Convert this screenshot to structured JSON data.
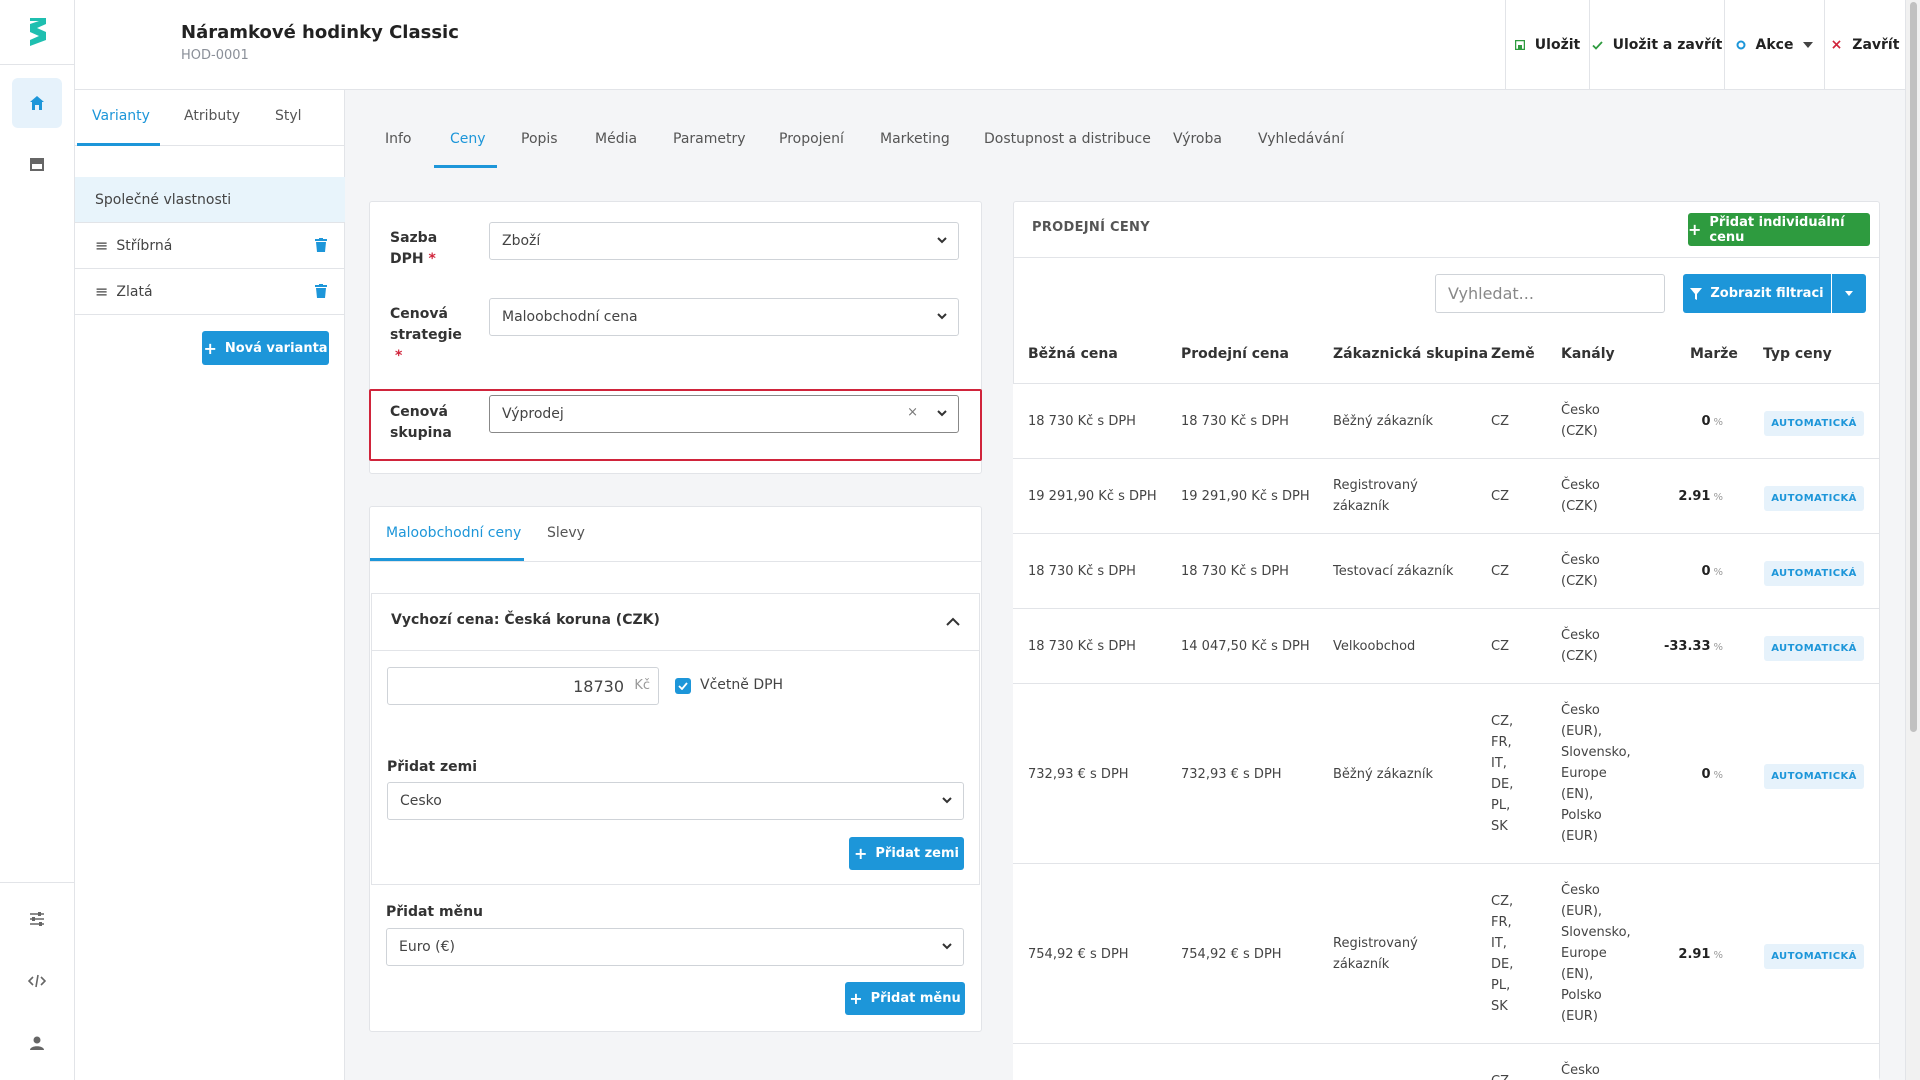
{
  "header": {
    "title": "Náramkové hodinky Classic",
    "code": "HOD-0001",
    "save": "Uložit",
    "save_close": "Uložit a zavřít",
    "actions": "Akce",
    "close": "Zavřít"
  },
  "rail": {
    "items": [
      "home-icon",
      "store-icon",
      "sliders-icon",
      "code-icon",
      "user-icon"
    ]
  },
  "variants": {
    "tabs": [
      "Varianty",
      "Atributy",
      "Styl"
    ],
    "shared": "Společné vlastnosti",
    "items": [
      "Stříbrná",
      "Zlatá"
    ],
    "new_button": "Nová varianta"
  },
  "main_tabs": [
    "Info",
    "Ceny",
    "Popis",
    "Média",
    "Parametry",
    "Propojení",
    "Marketing",
    "Dostupnost a distribuce",
    "Výroba",
    "Vyhledávání"
  ],
  "form": {
    "vat_label_1": "Sazba",
    "vat_label_2": "DPH",
    "vat_value": "Zboží",
    "strategy_label_1": "Cenová",
    "strategy_label_2": "strategie",
    "strategy_value": "Maloobchodní cena",
    "group_label_1": "Cenová",
    "group_label_2": "skupina",
    "group_value": "Výprodej",
    "required_mark": "*"
  },
  "price_tabs": [
    "Maloobchodní ceny",
    "Slevy"
  ],
  "default_price": {
    "title": "Vychozí cena: Česká koruna (CZK)",
    "value": "18730",
    "currency": "Kč",
    "incl_vat": "Včetně DPH",
    "add_country_label": "Přidat zemi",
    "country_value": "Cesko",
    "add_country_button": "Přidat zemi",
    "add_currency_label": "Přidat měnu",
    "currency_value": "Euro (€)",
    "add_currency_button": "Přidat měnu"
  },
  "sale_prices": {
    "title": "PRODEJNÍ CENY",
    "add_button": "Přidat individuální cenu",
    "search_placeholder": "Vyhledat...",
    "filter_button": "Zobrazit filtraci",
    "columns": [
      "Běžná cena",
      "Prodejní cena",
      "Zákaznická skupina",
      "Země",
      "Kanály",
      "Marže",
      "Typ ceny"
    ],
    "percent": "%",
    "rows": [
      {
        "regular": "18 730 Kč s DPH",
        "sale": "18 730 Kč s DPH",
        "group": [
          "Běžný zákazník"
        ],
        "country": [
          "CZ"
        ],
        "channels": [
          "Česko",
          "(CZK)"
        ],
        "margin": "0",
        "type": "AUTOMATICKÁ"
      },
      {
        "regular": "19 291,90 Kč s DPH",
        "sale": "19 291,90 Kč s DPH",
        "group": [
          "Registrovaný",
          "zákazník"
        ],
        "country": [
          "CZ"
        ],
        "channels": [
          "Česko",
          "(CZK)"
        ],
        "margin": "2.91",
        "type": "AUTOMATICKÁ"
      },
      {
        "regular": "18 730 Kč s DPH",
        "sale": "18 730 Kč s DPH",
        "group": [
          "Testovací zákazník"
        ],
        "country": [
          "CZ"
        ],
        "channels": [
          "Česko",
          "(CZK)"
        ],
        "margin": "0",
        "type": "AUTOMATICKÁ"
      },
      {
        "regular": "18 730 Kč s DPH",
        "sale": "14 047,50 Kč s DPH",
        "group": [
          "Velkoobchod"
        ],
        "country": [
          "CZ"
        ],
        "channels": [
          "Česko",
          "(CZK)"
        ],
        "margin": "-33.33",
        "type": "AUTOMATICKÁ"
      },
      {
        "regular": "732,93 € s DPH",
        "sale": "732,93 € s DPH",
        "group": [
          "Běžný zákazník"
        ],
        "country": [
          "CZ,",
          "FR,",
          "IT,",
          "DE,",
          "PL,",
          "SK"
        ],
        "channels": [
          "Česko",
          "(EUR),",
          "Slovensko,",
          "Europe",
          "(EN),",
          "Polsko",
          "(EUR)"
        ],
        "margin": "0",
        "type": "AUTOMATICKÁ"
      },
      {
        "regular": "754,92 € s DPH",
        "sale": "754,92 € s DPH",
        "group": [
          "Registrovaný",
          "zákazník"
        ],
        "country": [
          "CZ,",
          "FR,",
          "IT,",
          "DE,",
          "PL,",
          "SK"
        ],
        "channels": [
          "Česko",
          "(EUR),",
          "Slovensko,",
          "Europe",
          "(EN),",
          "Polsko",
          "(EUR)"
        ],
        "margin": "2.91",
        "type": "AUTOMATICKÁ"
      },
      {
        "regular": "",
        "sale": "",
        "group": [],
        "country": [
          "CZ"
        ],
        "channels": [
          "Česko"
        ],
        "margin": "",
        "type": ""
      }
    ]
  },
  "colors": {
    "accent": "#1d96d9",
    "success": "#2e9b3f",
    "danger": "#d0243b",
    "brand": "#1fbfb0"
  }
}
